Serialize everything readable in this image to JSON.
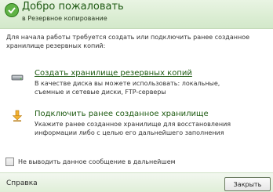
{
  "header": {
    "title": "Добро пожаловать",
    "subtitle": "в Резервное копирование"
  },
  "intro": "Для начала работы требуется создать или подключить ранее созданное хранилище резервных копий:",
  "options": [
    {
      "title": "Создать хранилище резервных копий",
      "description": "В качестве диска вы можете использовать: локальные, съемные и сетевые диски, FTP-серверы",
      "icon": "drive-icon"
    },
    {
      "title": "Подключить ранее созданное хранилище",
      "description": "Укажите ранее созданное хранилище для восстановления информации либо с целью его дальнейшего заполнения",
      "icon": "connect-arrow-icon"
    }
  ],
  "checkbox": {
    "label": "Не выводить данное сообщение в дальнейшем",
    "checked": false
  },
  "footer": {
    "help_label": "Справка",
    "close_label": "Закрыть"
  },
  "colors": {
    "header_bg": "#dbedd3",
    "title_green": "#1f5a14"
  }
}
